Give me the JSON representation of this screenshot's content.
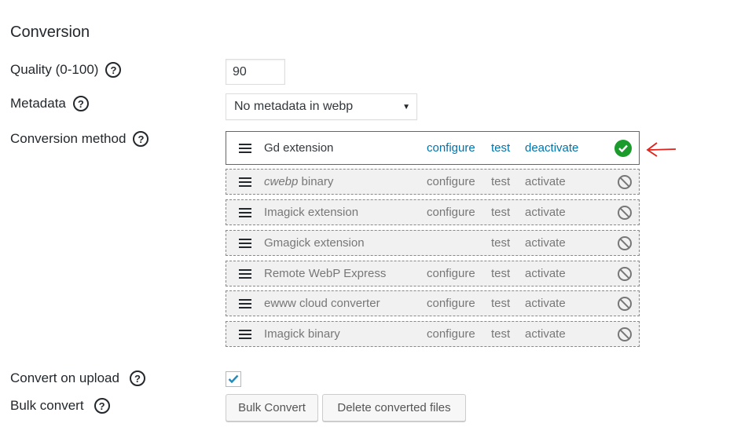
{
  "section": {
    "title": "Conversion"
  },
  "quality": {
    "label": "Quality (0-100)",
    "value": "90",
    "help": "?"
  },
  "metadata": {
    "label": "Metadata",
    "selected": "No metadata in webp",
    "help": "?"
  },
  "conversion_method": {
    "label": "Conversion method",
    "help": "?",
    "converters": [
      {
        "name": "Gd extension",
        "configure": "configure",
        "test": "test",
        "action": "deactivate",
        "status": "active"
      },
      {
        "name_italic": "cwebp",
        "name": " binary",
        "configure": "configure",
        "test": "test",
        "action": "activate",
        "status": "inactive"
      },
      {
        "name": "Imagick extension",
        "configure": "configure",
        "test": "test",
        "action": "activate",
        "status": "inactive"
      },
      {
        "name": "Gmagick extension",
        "test": "test",
        "action": "activate",
        "status": "inactive"
      },
      {
        "name": "Remote WebP Express",
        "configure": "configure",
        "test": "test",
        "action": "activate",
        "status": "inactive"
      },
      {
        "name": "ewww cloud converter",
        "configure": "configure",
        "test": "test",
        "action": "activate",
        "status": "inactive"
      },
      {
        "name": "Imagick binary",
        "configure": "configure",
        "test": "test",
        "action": "activate",
        "status": "inactive"
      }
    ]
  },
  "convert_on_upload": {
    "label": "Convert on upload",
    "checked": true,
    "help": "?"
  },
  "bulk_convert": {
    "label": "Bulk convert",
    "help": "?",
    "bulk_button": "Bulk Convert",
    "delete_button": "Delete converted files"
  },
  "colors": {
    "link": "#0073aa",
    "active_ok": "#1a9b2c",
    "annotation": "#e0201a"
  },
  "icons": {
    "drag": "hamburger-icon",
    "ok": "check-circle-icon",
    "off": "ban-icon",
    "help": "question-circle-icon"
  }
}
